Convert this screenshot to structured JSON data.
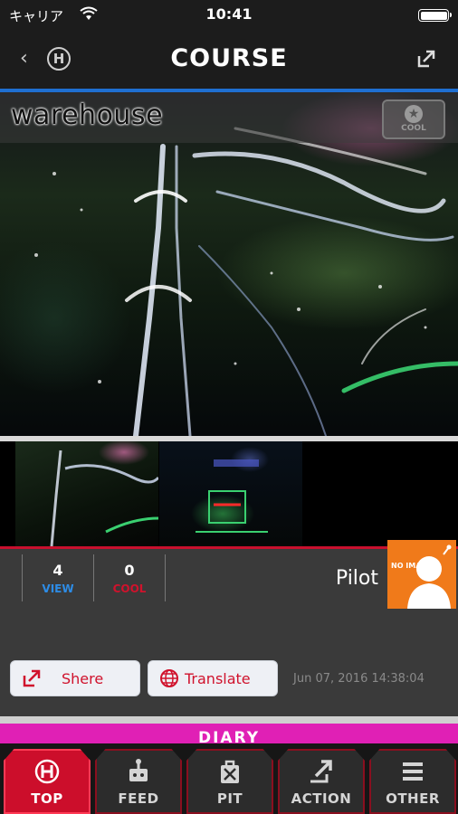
{
  "status_bar": {
    "carrier": "キャリア",
    "time": "10:41"
  },
  "nav": {
    "title": "COURSE",
    "home_letter": "H"
  },
  "course": {
    "name": "warehouse",
    "cool_badge_label": "COOL"
  },
  "stats": {
    "views": "4",
    "views_label": "VIEW",
    "cools": "0",
    "cools_label": "COOL"
  },
  "pilot": {
    "name": "Pilot",
    "avatar_text": "NO IMAGE"
  },
  "buttons": {
    "share": "Shere",
    "translate": "Translate"
  },
  "timestamp": "Jun 07, 2016 14:38:04",
  "diary": "DIARY",
  "tabs": [
    {
      "label": "TOP",
      "icon": "home-icon",
      "active": true
    },
    {
      "label": "FEED",
      "icon": "drone-icon",
      "active": false
    },
    {
      "label": "PIT",
      "icon": "pit-icon",
      "active": false
    },
    {
      "label": "ACTION",
      "icon": "action-icon",
      "active": false
    },
    {
      "label": "OTHER",
      "icon": "menu-icon",
      "active": false
    }
  ],
  "colors": {
    "accent_red": "#cc0e2b",
    "view_blue": "#2d8ce6",
    "cool_red": "#d0122c",
    "diary_magenta": "#e020b5",
    "pilot_orange": "#f07a1a"
  }
}
